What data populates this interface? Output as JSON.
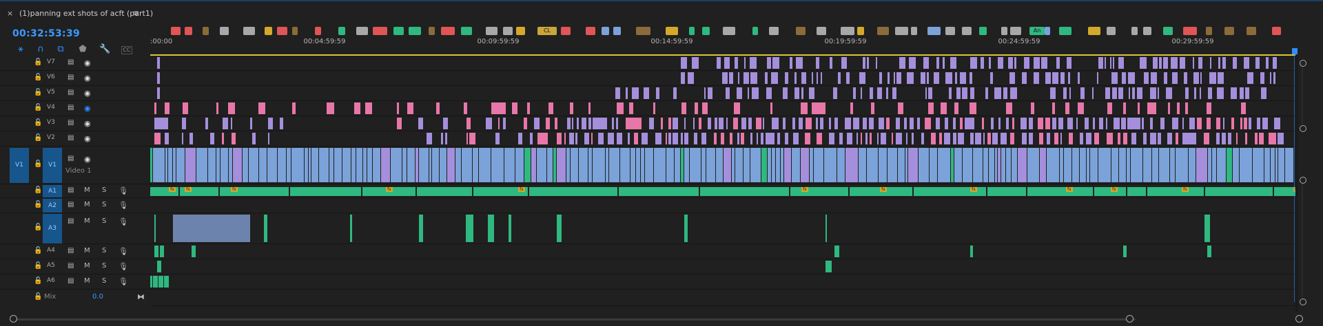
{
  "sequence": {
    "close_glyph": "×",
    "title": "(1)panning ext shots of acft (part1)",
    "menu_glyph": "≡"
  },
  "timecode": "00:32:53:39",
  "toolbar": [
    {
      "name": "snap-insert-icon",
      "glyph": "⚹",
      "active": true
    },
    {
      "name": "snap-magnet-icon",
      "glyph": "∩",
      "active": true
    },
    {
      "name": "linked-selection-icon",
      "glyph": "⧉",
      "active": true
    },
    {
      "name": "add-marker-icon",
      "glyph": "⬟",
      "active": false
    },
    {
      "name": "wrench-icon",
      "glyph": "🔧",
      "active": false
    },
    {
      "name": "captions-icon",
      "glyph": "CC",
      "active": false
    }
  ],
  "ruler": {
    "labels": [
      ":00:00",
      "00:04:59:59",
      "00:09:59:59",
      "00:14:59:59",
      "00:19:59:59",
      "00:24:59:59",
      "00:29:59:59"
    ],
    "marker_texts": [
      "CL",
      "An"
    ]
  },
  "colors": {
    "accent": "#2f8fff",
    "violet": "#a58fdc",
    "pink": "#e877a9",
    "blue": "#7ba2d9",
    "green": "#2fb880",
    "playline": "#d8c83a"
  },
  "video_tracks": [
    {
      "id": "V7",
      "eye": "normal"
    },
    {
      "id": "V6",
      "eye": "normal"
    },
    {
      "id": "V5",
      "eye": "normal"
    },
    {
      "id": "V4",
      "eye": "blue"
    },
    {
      "id": "V3",
      "eye": "normal"
    },
    {
      "id": "V2",
      "eye": "normal"
    },
    {
      "id": "V1",
      "eye": "normal",
      "target": "V1",
      "label": "Video 1"
    }
  ],
  "audio_tracks": [
    {
      "id": "A1",
      "m": "M",
      "s": "S"
    },
    {
      "id": "A2",
      "m": "M",
      "s": "S"
    },
    {
      "id": "A3",
      "m": "M",
      "s": "S"
    },
    {
      "id": "A4",
      "m": "M",
      "s": "S"
    },
    {
      "id": "A5",
      "m": "M",
      "s": "S"
    },
    {
      "id": "A6",
      "m": "M",
      "s": "S"
    }
  ],
  "mix": {
    "label": "Mix",
    "value": "0.0"
  },
  "fx_badge": "fx"
}
